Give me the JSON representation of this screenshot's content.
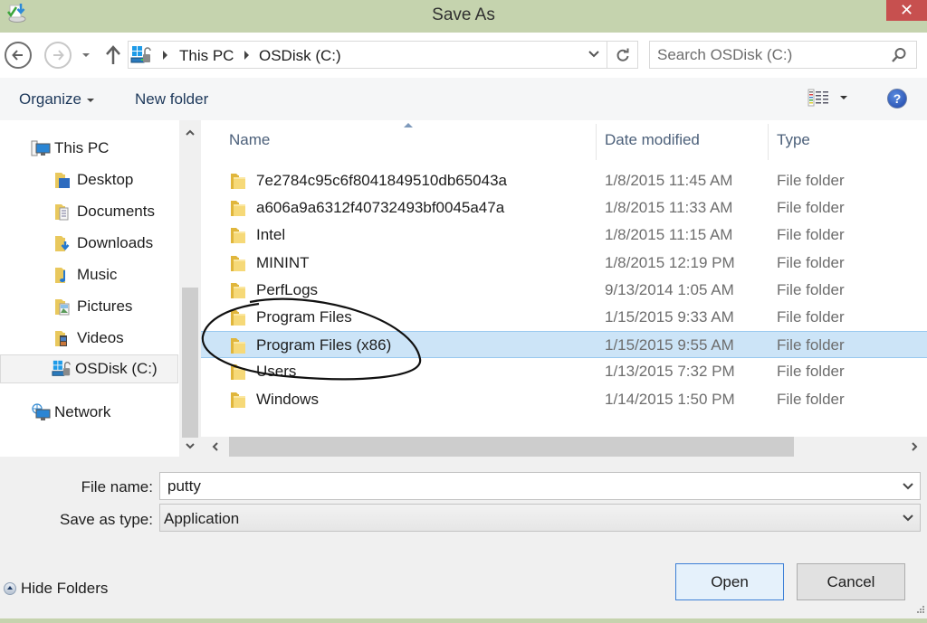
{
  "window": {
    "title": "Save As",
    "close_label": "✕"
  },
  "navigation": {
    "breadcrumbs": [
      "This PC",
      "OSDisk (C:)"
    ],
    "search_placeholder": "Search OSDisk (C:)"
  },
  "toolbar": {
    "organize_label": "Organize",
    "new_folder_label": "New folder",
    "help_label": "?"
  },
  "sidebar": {
    "items": [
      {
        "label": "This PC",
        "icon": "computer-icon"
      },
      {
        "label": "Desktop",
        "icon": "desktop-folder-icon"
      },
      {
        "label": "Documents",
        "icon": "documents-folder-icon"
      },
      {
        "label": "Downloads",
        "icon": "downloads-folder-icon"
      },
      {
        "label": "Music",
        "icon": "music-folder-icon"
      },
      {
        "label": "Pictures",
        "icon": "pictures-folder-icon"
      },
      {
        "label": "Videos",
        "icon": "videos-folder-icon"
      },
      {
        "label": "OSDisk (C:)",
        "icon": "drive-icon",
        "selected": true
      },
      {
        "label": "Network",
        "icon": "network-icon"
      }
    ]
  },
  "filelist": {
    "columns": [
      "Name",
      "Date modified",
      "Type"
    ],
    "rows": [
      {
        "name": "7e2784c95c6f8041849510db65043a",
        "date": "1/8/2015 11:45 AM",
        "type": "File folder"
      },
      {
        "name": "a606a9a6312f40732493bf0045a47a",
        "date": "1/8/2015 11:33 AM",
        "type": "File folder"
      },
      {
        "name": "Intel",
        "date": "1/8/2015 11:15 AM",
        "type": "File folder"
      },
      {
        "name": "MININT",
        "date": "1/8/2015 12:19 PM",
        "type": "File folder"
      },
      {
        "name": "PerfLogs",
        "date": "9/13/2014 1:05 AM",
        "type": "File folder"
      },
      {
        "name": "Program Files",
        "date": "1/15/2015 9:33 AM",
        "type": "File folder"
      },
      {
        "name": "Program Files (x86)",
        "date": "1/15/2015 9:55 AM",
        "type": "File folder",
        "selected": true
      },
      {
        "name": "Users",
        "date": "1/13/2015 7:32 PM",
        "type": "File folder"
      },
      {
        "name": "Windows",
        "date": "1/14/2015 1:50 PM",
        "type": "File folder"
      }
    ]
  },
  "form": {
    "file_name_label": "File name:",
    "file_name_value": "putty",
    "save_type_label": "Save as type:",
    "save_type_value": "Application"
  },
  "footer": {
    "hide_folders_label": "Hide Folders",
    "open_label": "Open",
    "cancel_label": "Cancel"
  },
  "colors": {
    "titlebar": "#c5d3ae",
    "close": "#c7504f",
    "selection": "#cce4f7",
    "selection_border": "#99c9ef"
  }
}
